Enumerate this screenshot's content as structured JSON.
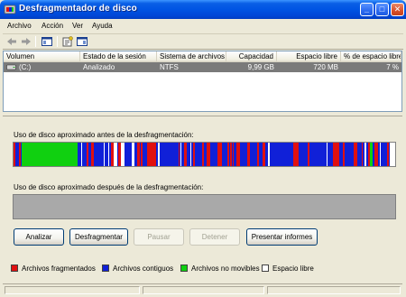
{
  "window": {
    "title": "Desfragmentador de disco",
    "buttons": {
      "minimize": "_",
      "maximize": "□",
      "close": "✕"
    }
  },
  "menu": {
    "items": [
      {
        "label": "Archivo"
      },
      {
        "label": "Acción"
      },
      {
        "label": "Ver"
      },
      {
        "label": "Ayuda"
      }
    ]
  },
  "toolbar": {
    "icons": [
      "back-arrow-icon",
      "forward-arrow-icon",
      "console-icon",
      "properties-icon",
      "help-icon"
    ]
  },
  "volume_list": {
    "columns": [
      {
        "label": "Volumen"
      },
      {
        "label": "Estado de la sesión"
      },
      {
        "label": "Sistema de archivos"
      },
      {
        "label": "Capacidad"
      },
      {
        "label": "Espacio libre"
      },
      {
        "label": "% de espacio libre"
      }
    ],
    "rows": [
      {
        "volume": "(C:)",
        "status": "Analizado",
        "filesystem": "NTFS",
        "capacity": "9,99 GB",
        "free": "720 MB",
        "free_pct": "7 %"
      }
    ]
  },
  "panel": {
    "before_label": "Uso de disco aproximado antes de la desfragmentación:",
    "after_label": "Uso de disco aproximado después de la desfragmentación:"
  },
  "buttons": {
    "analyze": "Analizar",
    "defragment": "Desfragmentar",
    "pause": "Pausar",
    "stop": "Detener",
    "report": "Presentar informes"
  },
  "legend": {
    "items": [
      {
        "label": "Archivos fragmentados",
        "color": "#e01010"
      },
      {
        "label": "Archivos contiguos",
        "color": "#1020d8"
      },
      {
        "label": "Archivos no movibles",
        "color": "#10d010"
      },
      {
        "label": "Espacio libre",
        "color": "#ffffff"
      }
    ]
  },
  "colors": {
    "title_bar": "#0054e3",
    "fragmented": "#e01010",
    "contiguous": "#1020d8",
    "unmovable": "#10d010",
    "free": "#ffffff",
    "empty_map": "#a9a9a9"
  }
}
